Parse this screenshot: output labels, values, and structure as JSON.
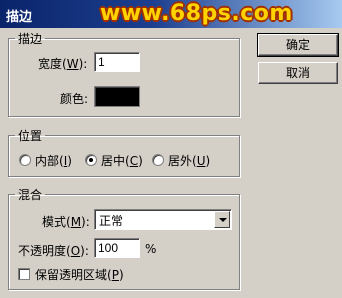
{
  "window": {
    "title": "描边",
    "watermark": "www.68ps.com"
  },
  "stroke": {
    "legend": "描边",
    "width_label_pre": "宽度(",
    "width_label_key": "W",
    "width_label_post": "):",
    "width_value": "1",
    "color_label": "颜色:",
    "color_value": "#000000"
  },
  "position": {
    "legend": "位置",
    "options": [
      {
        "pre": "内部(",
        "key": "I",
        "post": ")",
        "selected": false
      },
      {
        "pre": "居中(",
        "key": "C",
        "post": ")",
        "selected": true
      },
      {
        "pre": "居外(",
        "key": "U",
        "post": ")",
        "selected": false
      }
    ]
  },
  "blend": {
    "legend": "混合",
    "mode_label_pre": "模式(",
    "mode_label_key": "M",
    "mode_label_post": "):",
    "mode_value": "正常",
    "opacity_label_pre": "不透明度(",
    "opacity_label_key": "O",
    "opacity_label_post": "):",
    "opacity_value": "100",
    "opacity_unit": "%",
    "preserve_pre": "保留透明区域(",
    "preserve_key": "P",
    "preserve_post": ")",
    "preserve_checked": false
  },
  "buttons": {
    "ok": "确定",
    "cancel": "取消"
  }
}
